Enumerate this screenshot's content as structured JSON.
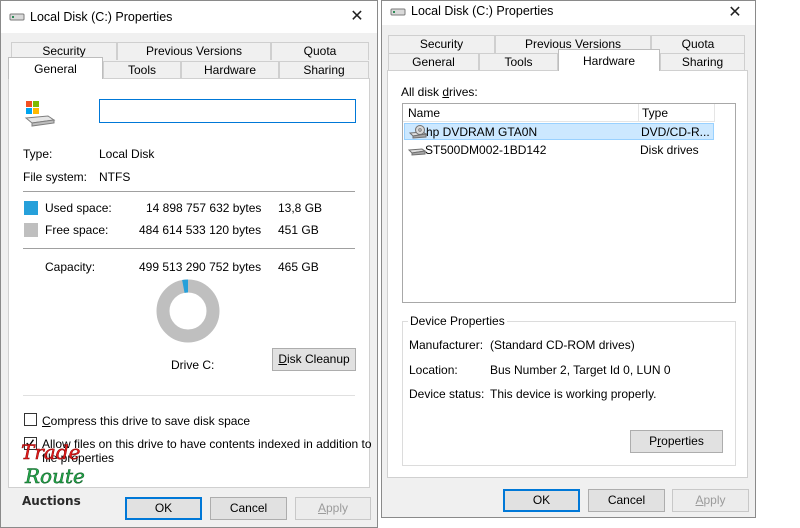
{
  "left_dialog": {
    "title": "Local Disk (C:) Properties",
    "tabs_back": [
      "Security",
      "Previous Versions",
      "Quota"
    ],
    "tabs_front": [
      "General",
      "Tools",
      "Hardware",
      "Sharing"
    ],
    "active_tab": "General",
    "name_input_value": "",
    "type_label": "Type:",
    "type_value": "Local Disk",
    "fs_label": "File system:",
    "fs_value": "NTFS",
    "used_label": "Used space:",
    "used_bytes": "14 898 757 632 bytes",
    "used_size": "13,8 GB",
    "free_label": "Free space:",
    "free_bytes": "484 614 533 120 bytes",
    "free_size": "451 GB",
    "capacity_label": "Capacity:",
    "capacity_bytes": "499 513 290 752 bytes",
    "capacity_size": "465 GB",
    "used_fraction": 0.0298,
    "drive_label": "Drive C:",
    "cleanup_prefix": "D",
    "cleanup_rest": "isk Cleanup",
    "compress_label_u": "C",
    "compress_label_rest": "ompress this drive to save disk space",
    "index_label": "Allow files on this drive to have contents indexed in addition to",
    "index_label_2": "file properties",
    "ok_label": "OK",
    "cancel_label": "Cancel",
    "apply_prefix": "A",
    "apply_rest": "pply",
    "colors": {
      "used": "#26a0da",
      "free": "#bfbfbf",
      "accent": "#0078d7"
    }
  },
  "right_dialog": {
    "title": "Local Disk (C:) Properties",
    "tabs_back": [
      "Security",
      "Previous Versions",
      "Quota"
    ],
    "tabs_front": [
      "General",
      "Tools",
      "Hardware",
      "Sharing"
    ],
    "active_tab": "Hardware",
    "all_drives_label_pre": "All disk ",
    "all_drives_label_u": "d",
    "all_drives_label_post": "rives:",
    "col_name": "Name",
    "col_type": "Type",
    "drives": [
      {
        "name": "hp DVDRAM GTA0N",
        "type": "DVD/CD-R...",
        "selected": true
      },
      {
        "name": "ST500DM002-1BD142",
        "type": "Disk drives",
        "selected": false
      }
    ],
    "device_props_title": "Device Properties",
    "manufacturer_label": "Manufacturer:",
    "manufacturer_value": "(Standard CD-ROM drives)",
    "location_label": "Location:",
    "location_value": "Bus Number 2, Target Id 0, LUN 0",
    "status_label": "Device status:",
    "status_value": "This device is working properly.",
    "properties_pre": "P",
    "properties_u": "r",
    "properties_post": "operties",
    "ok_label": "OK",
    "cancel_label": "Cancel",
    "apply_prefix": "A",
    "apply_rest": "pply"
  },
  "watermark": {
    "line1": "Trade",
    "line2": "Route",
    "line3": "Auctions"
  }
}
